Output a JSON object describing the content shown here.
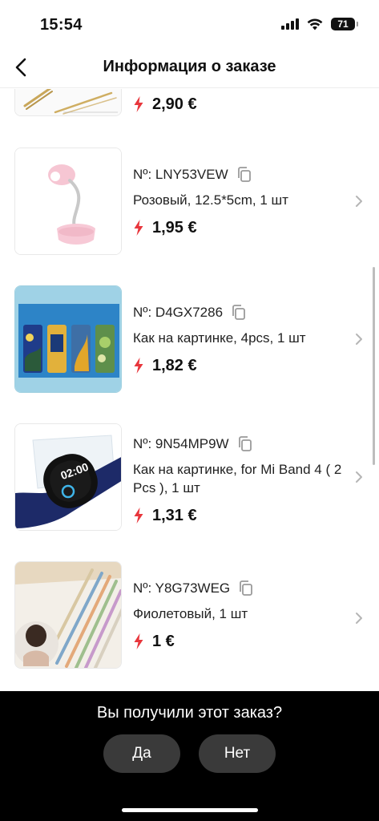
{
  "status_bar": {
    "time": "15:54",
    "battery": "71"
  },
  "header": {
    "title": "Информация о заказе"
  },
  "colors": {
    "accent_red": "#e8363c",
    "copy_icon": "#9a9a9a",
    "chevron": "#b5b5b5",
    "bottom_bar": "#000000",
    "button_bg": "#3a3a3a"
  },
  "items": [
    {
      "sku": "",
      "variant": "",
      "price": "2,90 €",
      "image": "gold-hair-pins"
    },
    {
      "sku": "Nº: LNY53VEW",
      "variant": "Розовый, 12.5*5cm, 1 шт",
      "price": "1,95 €",
      "image": "pink-clip-lamp"
    },
    {
      "sku": "Nº: D4GX7286",
      "variant": "Как на картинке, 4pcs, 1 шт",
      "price": "1,82 €",
      "image": "van-gogh-bookmarks"
    },
    {
      "sku": "Nº: 9N54MP9W",
      "variant": "Как на картинке, for Mi Band 4 ( 2 Pcs  ), 1 шт",
      "price": "1,31 €",
      "image": "mi-band-screen-protector"
    },
    {
      "sku": "Nº: Y8G73WEG",
      "variant": "Фиолетовый, 1 шт",
      "price": "1 €",
      "image": "hair-sticks"
    }
  ],
  "prompt": {
    "question": "Вы получили этот заказ?",
    "yes_label": "Да",
    "no_label": "Нет"
  }
}
